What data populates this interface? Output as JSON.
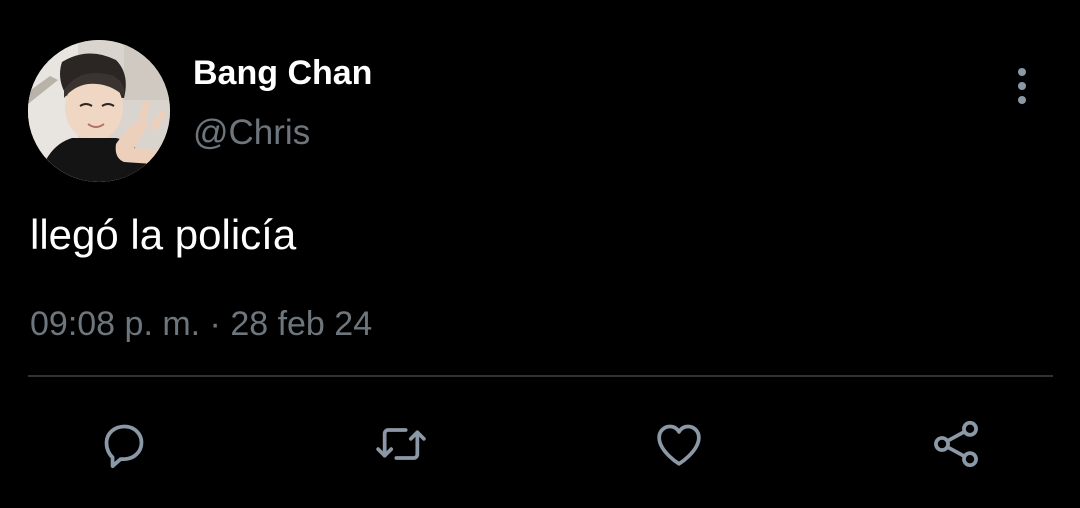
{
  "tweet": {
    "author": {
      "display_name": "Bang Chan",
      "handle": "@Chris"
    },
    "text": "llegó la policía",
    "timestamp": "09:08 p. m. · 28 feb 24"
  },
  "actions": {
    "reply_icon": "reply-icon",
    "retweet_icon": "retweet-icon",
    "like_icon": "heart-icon",
    "share_icon": "share-icon",
    "more_icon": "more-vertical-icon"
  },
  "colors": {
    "background": "#000000",
    "primary_text": "#ffffff",
    "secondary_text": "#6e767d",
    "icon": "#8b98a5",
    "divider": "#2f3336"
  }
}
